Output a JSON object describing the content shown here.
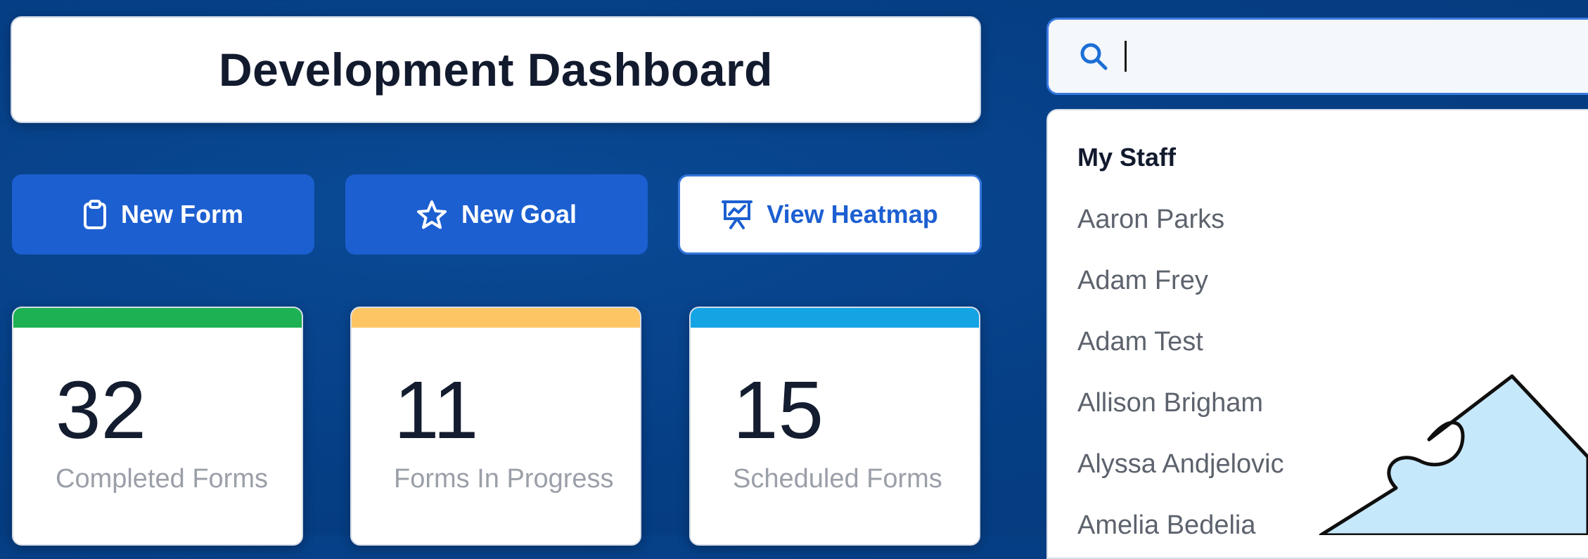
{
  "header": {
    "title": "Development Dashboard"
  },
  "actions": {
    "new_form": "New Form",
    "new_goal": "New Goal",
    "view_heatmap": "View Heatmap"
  },
  "stats": [
    {
      "value": "32",
      "label": "Completed Forms",
      "color": "#1db153"
    },
    {
      "value": "11",
      "label": "Forms In Progress",
      "color": "#fdc564"
    },
    {
      "value": "15",
      "label": "Scheduled Forms",
      "color": "#14a4e4"
    }
  ],
  "search": {
    "value": "",
    "placeholder": ""
  },
  "dropdown": {
    "heading": "My Staff",
    "items": [
      "Aaron Parks",
      "Adam Frey",
      "Adam Test",
      "Allison Brigham",
      "Alyssa Andjelovic",
      "Amelia Bedelia"
    ]
  },
  "colors": {
    "accent": "#1c5fd1",
    "background": "#063f86",
    "puzzle": "#c6e8fb"
  },
  "icons": [
    "clipboard-icon",
    "star-icon",
    "presentation-chart-icon",
    "search-icon",
    "puzzle-piece-icon"
  ]
}
